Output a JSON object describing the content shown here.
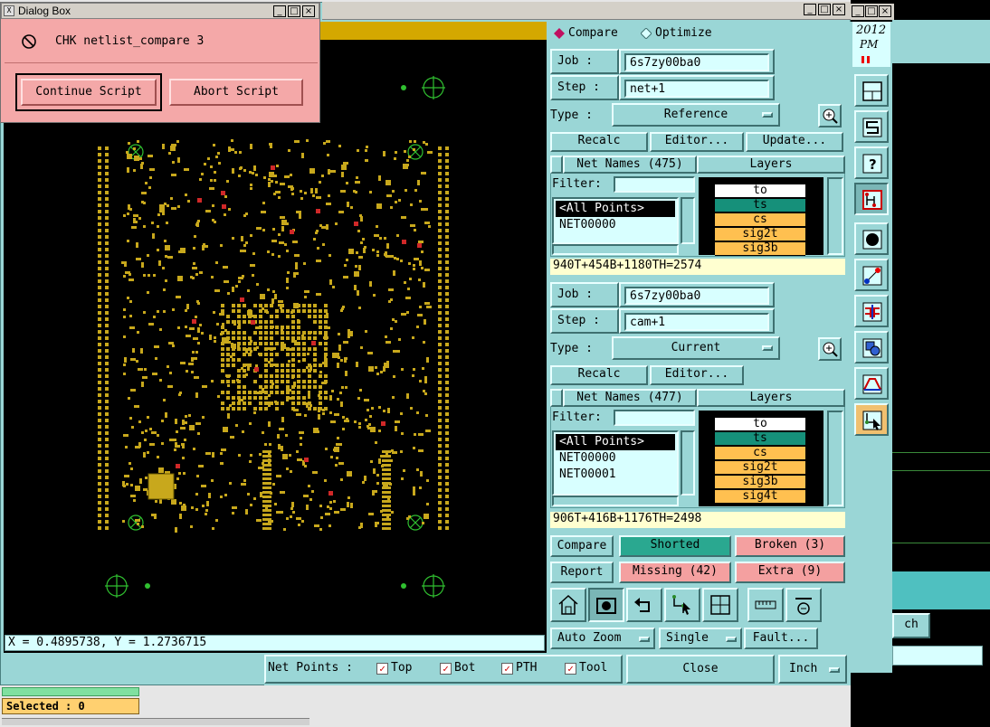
{
  "dialog": {
    "title": "Dialog Box",
    "message": "CHK netlist_compare 3",
    "continue_label": "Continue Script",
    "abort_label": "Abort Script"
  },
  "coords": {
    "readout": "X = 0.4895738, Y = 1.2736715"
  },
  "mode": {
    "compare": "Compare",
    "optimize": "Optimize"
  },
  "reference": {
    "job_label": "Job  :",
    "job_value": "6s7zy00ba0",
    "step_label": "Step :",
    "step_value": "net+1",
    "type_label": "Type :",
    "type_value": "Reference",
    "recalc": "Recalc",
    "editor": "Editor...",
    "update": "Update...",
    "netnames": "Net Names (475)",
    "layers_header": "Layers",
    "filter_label": "Filter:",
    "nets": [
      "<All Points>",
      "NET00000"
    ],
    "layers": [
      "to",
      "ts",
      "cs",
      "sig2t",
      "sig3b"
    ],
    "stats": "940T+454B+1180TH=2574"
  },
  "current": {
    "job_label": "Job  :",
    "job_value": "6s7zy00ba0",
    "step_label": "Step :",
    "step_value": "cam+1",
    "type_label": "Type :",
    "type_value": "Current",
    "recalc": "Recalc",
    "editor": "Editor...",
    "netnames": "Net Names (477)",
    "layers_header": "Layers",
    "filter_label": "Filter:",
    "nets": [
      "<All Points>",
      "NET00000",
      "NET00001"
    ],
    "layers": [
      "to",
      "ts",
      "cs",
      "sig2t",
      "sig3b",
      "sig4t"
    ],
    "stats": "906T+416B+1176TH=2498"
  },
  "results": {
    "compare": "Compare",
    "shorted": "Shorted",
    "broken": "Broken (3)",
    "report": "Report",
    "missing": "Missing (42)",
    "extra": "Extra (9)"
  },
  "bottom": {
    "autozoom": "Auto Zoom",
    "single": "Single",
    "fault": "Fault...",
    "netpoints_label": "Net Points :",
    "top": "Top",
    "bot": "Bot",
    "pth": "PTH",
    "tool": "Tool",
    "close": "Close",
    "units": "Inch"
  },
  "clock": {
    "year": "2012",
    "ampm": "PM"
  },
  "bg_window": {
    "units": "ch"
  },
  "status": {
    "selected": "Selected : 0"
  },
  "colors": {
    "panel": "#9ad6d6",
    "dialog": "#f4a8a8",
    "pad": "#c8a81c",
    "alert": "#f4a0a0",
    "layer_teal": "#16907a",
    "layer_orange": "#ffc050"
  }
}
